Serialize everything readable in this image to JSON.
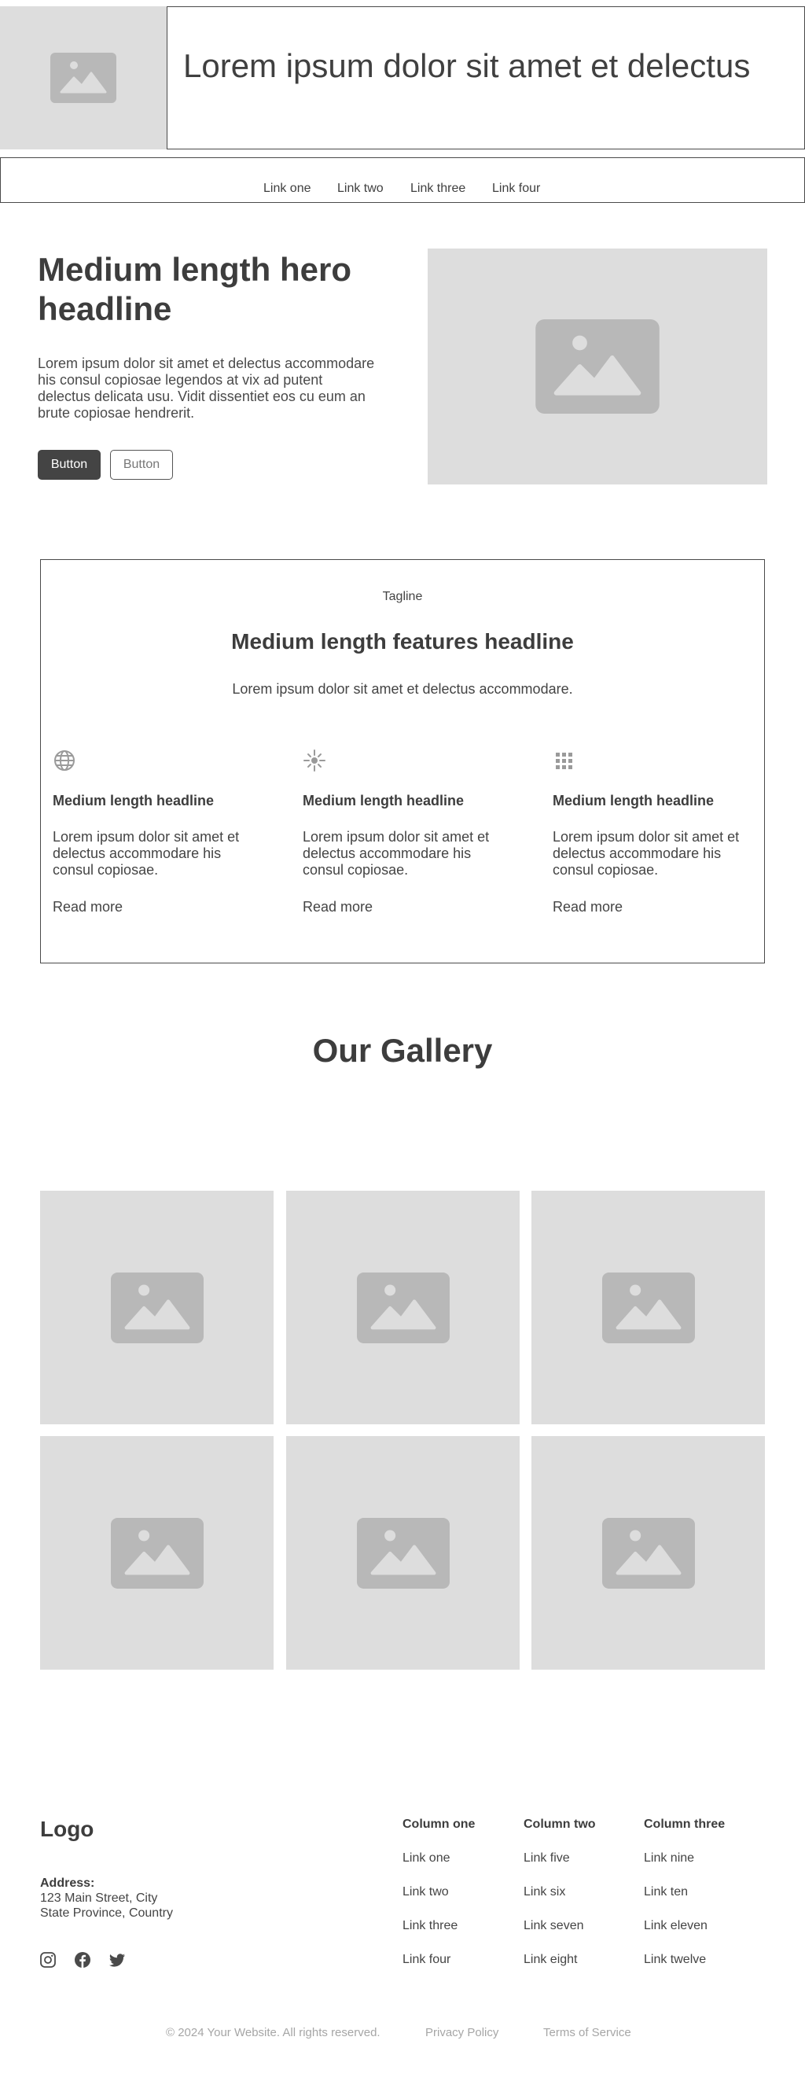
{
  "header": {
    "title": "Lorem ipsum dolor sit amet et delectus",
    "image_icon": "image-placeholder-icon"
  },
  "nav": {
    "links": [
      "Link one",
      "Link two",
      "Link three",
      "Link four"
    ]
  },
  "hero": {
    "headline": "Medium length hero headline",
    "text": "Lorem ipsum dolor sit amet et delectus accommodare his consul copiosae legendos at vix ad putent delectus delicata usu. Vidit dissentiet eos cu eum an brute copiosae hendrerit.",
    "primary_button": "Button",
    "secondary_button": "Button",
    "image_icon": "image-placeholder-icon"
  },
  "features": {
    "tagline": "Tagline",
    "headline": "Medium length features headline",
    "subtext": "Lorem ipsum dolor sit amet et delectus accommodare.",
    "items": [
      {
        "icon": "globe-icon",
        "headline": "Medium length headline",
        "text": "Lorem ipsum dolor sit amet et delectus accommodare his consul copiosae.",
        "link": "Read more"
      },
      {
        "icon": "sparkle-icon",
        "headline": "Medium length headline",
        "text": "Lorem ipsum dolor sit amet et delectus accommodare his consul copiosae.",
        "link": "Read more"
      },
      {
        "icon": "grid-icon",
        "headline": "Medium length headline",
        "text": "Lorem ipsum dolor sit amet et delectus accommodare his consul copiosae.",
        "link": "Read more"
      }
    ]
  },
  "gallery": {
    "title": "Our Gallery",
    "image_count": 6,
    "image_icon": "image-placeholder-icon"
  },
  "footer": {
    "logo": "Logo",
    "address_label": "Address:",
    "address_lines": [
      "123 Main Street, City",
      "State Province, Country"
    ],
    "social_icons": [
      "instagram-icon",
      "facebook-icon",
      "twitter-icon"
    ],
    "columns": [
      {
        "title": "Column one",
        "links": [
          "Link one",
          "Link two",
          "Link three",
          "Link four"
        ]
      },
      {
        "title": "Column two",
        "links": [
          "Link five",
          "Link six",
          "Link seven",
          "Link eight"
        ]
      },
      {
        "title": "Column three",
        "links": [
          "Link nine",
          "Link ten",
          "Link eleven",
          "Link twelve"
        ]
      }
    ],
    "copyright": "© 2024 Your Website. All rights reserved.",
    "privacy": "Privacy Policy",
    "terms": "Terms of Service"
  },
  "colors": {
    "text": "#3f3f3f",
    "placeholder_bg": "#dddddd",
    "placeholder_icon": "#b8b8b8",
    "primary_button": "#444444",
    "muted": "#a6a6a6"
  }
}
